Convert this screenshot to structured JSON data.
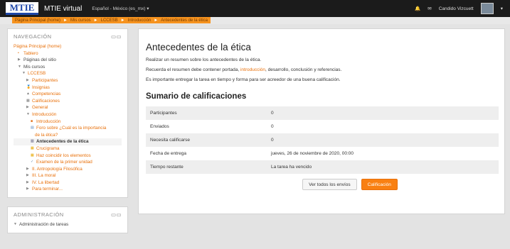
{
  "topbar": {
    "logo": "MTIE",
    "site_name": "MTIE virtual",
    "language": "Español - México (es_mx) ▾",
    "user_name": "Candido Vizcuett"
  },
  "breadcrumb": [
    "Página Principal (home)",
    "Mis cursos",
    "LCCESB",
    "Introducción",
    "Antecedentes de la ética"
  ],
  "nav": {
    "title": "NAVEGACIÓN",
    "items": [
      {
        "label": "Página Principal (home)",
        "style": "orange",
        "indent": 0,
        "icon": ""
      },
      {
        "label": "Tablero",
        "style": "orange",
        "indent": 1,
        "icon": "bullet"
      },
      {
        "label": "Páginas del sitio",
        "style": "",
        "indent": 1,
        "icon": "tri-right"
      },
      {
        "label": "Mis cursos",
        "style": "",
        "indent": 1,
        "icon": "tri-down"
      },
      {
        "label": "LCCESB",
        "style": "orange",
        "indent": 2,
        "icon": "tri-down"
      },
      {
        "label": "Participantes",
        "style": "orange",
        "indent": 3,
        "icon": "tri-right"
      },
      {
        "label": "Insignias",
        "style": "orange",
        "indent": 3,
        "icon": "badge"
      },
      {
        "label": "Competencias",
        "style": "orange",
        "indent": 3,
        "icon": "competency"
      },
      {
        "label": "Calificaciones",
        "style": "orange",
        "indent": 3,
        "icon": "grades"
      },
      {
        "label": "General",
        "style": "orange",
        "indent": 3,
        "icon": "tri-right"
      },
      {
        "label": "Introducción",
        "style": "orange",
        "indent": 3,
        "icon": "tri-down"
      },
      {
        "label": "Introducción",
        "style": "orange",
        "indent": 4,
        "icon": "page"
      },
      {
        "label": "Foro sobre ¿Cuál es la importancia",
        "style": "orange",
        "indent": 4,
        "icon": "forum"
      },
      {
        "label": "de la ética?",
        "style": "orange",
        "indent": 5,
        "icon": ""
      },
      {
        "label": "Antecedentes de la ética",
        "style": "active",
        "indent": 4,
        "icon": "assign"
      },
      {
        "label": "Crucigrama",
        "style": "orange",
        "indent": 4,
        "icon": "crossword"
      },
      {
        "label": "Haz coincidir los elementos",
        "style": "orange",
        "indent": 4,
        "icon": "match"
      },
      {
        "label": "Examen de la primer unidad",
        "style": "orange",
        "indent": 4,
        "icon": "quiz"
      },
      {
        "label": "II. Antropología Filosófica",
        "style": "orange",
        "indent": 3,
        "icon": "tri-right"
      },
      {
        "label": "III. La moral",
        "style": "orange",
        "indent": 3,
        "icon": "tri-right"
      },
      {
        "label": "IV. La libertad",
        "style": "orange",
        "indent": 3,
        "icon": "tri-right"
      },
      {
        "label": "Para terminar...",
        "style": "orange",
        "indent": 3,
        "icon": "tri-right"
      }
    ]
  },
  "admin": {
    "title": "ADMINISTRACIÓN",
    "item": "Administración de tareas"
  },
  "main": {
    "title": "Antecedentes de la ética",
    "para1": "Realizar un resumen sobre los antecedentes de la ética.",
    "para2_a": "Recuerda el resumen  debe contener portada, ",
    "para2_link": "introducción",
    "para2_b": ", desarrollo, conclusión y referencias.",
    "para3": "Es importante entregar la tarea en tiempo y forma para ser acreedor de una buena calificación.",
    "summary_title": "Sumario de calificaciones",
    "rows": [
      {
        "label": "Participantes",
        "value": "0"
      },
      {
        "label": "Enviados",
        "value": "0"
      },
      {
        "label": "Necesita calificarse",
        "value": "0"
      },
      {
        "label": "Fecha de entrega",
        "value": "jueves, 26 de noviembre de 2020, 00:00"
      },
      {
        "label": "Tiempo restante",
        "value": "La tarea ha vencido"
      }
    ],
    "btn_view": "Ver todos los envíos",
    "btn_grade": "Calificación"
  },
  "colors": {
    "accent": "#f98012",
    "link": "#e8700a",
    "topbar": "#1b1b1b"
  }
}
